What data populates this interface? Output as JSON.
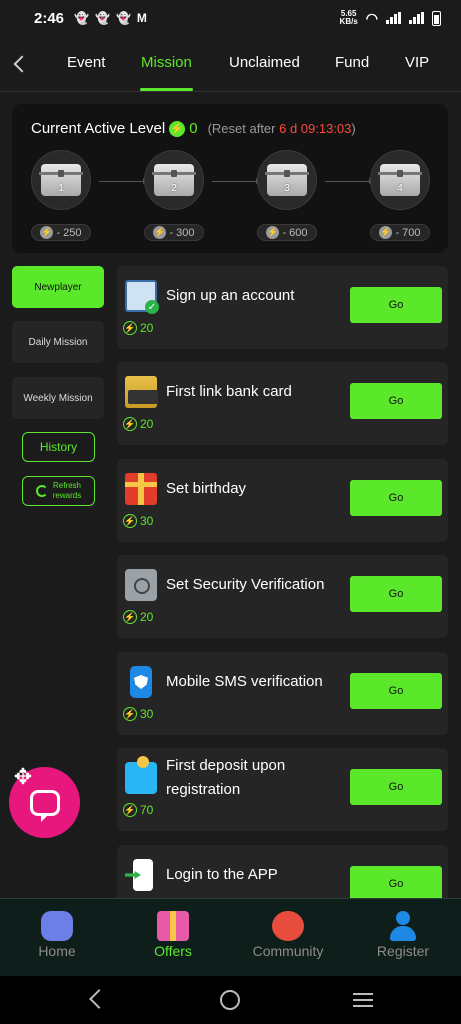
{
  "status_bar": {
    "time": "2:46",
    "speed": "5.65",
    "speed_unit": "KB/s",
    "notif_icons": [
      "snapchat-icon",
      "snapchat-icon",
      "snapchat-icon",
      "gmail-icon"
    ]
  },
  "tabs": [
    {
      "label": "Event"
    },
    {
      "label": "Mission"
    },
    {
      "label": "Unclaimed"
    },
    {
      "label": "Fund"
    },
    {
      "label": "VIP"
    }
  ],
  "level": {
    "title": "Current Active Level",
    "value": "0",
    "reset_prefix": "(Reset after ",
    "countdown": "6 d 09:13:03",
    "reset_suffix": ")",
    "chests": [
      {
        "number": "1",
        "points": "250"
      },
      {
        "number": "2",
        "points": "300"
      },
      {
        "number": "3",
        "points": "600"
      },
      {
        "number": "4",
        "points": "700"
      }
    ]
  },
  "side_nav": {
    "newplayer": "Newplayer",
    "daily": "Daily Mission",
    "weekly": "Weekly Mission",
    "history": "History",
    "refresh_line1": "Refresh",
    "refresh_line2": "rewards"
  },
  "missions": [
    {
      "title": "Sign up an account",
      "reward": "20",
      "button": "Go",
      "icon": "clipboard-check-icon"
    },
    {
      "title": "First link bank card",
      "reward": "20",
      "button": "Go",
      "icon": "bank-card-icon"
    },
    {
      "title": "Set birthday",
      "reward": "30",
      "button": "Go",
      "icon": "gift-icon"
    },
    {
      "title": "Set Security Verification",
      "reward": "20",
      "button": "Go",
      "icon": "safe-icon"
    },
    {
      "title": "Mobile SMS verification",
      "reward": "30",
      "button": "Go",
      "icon": "phone-shield-icon"
    },
    {
      "title": "First deposit upon registration",
      "reward": "70",
      "button": "Go",
      "icon": "wallet-coin-icon"
    },
    {
      "title": "Login to the APP",
      "reward": "",
      "button": "Go",
      "icon": "phone-login-icon"
    }
  ],
  "bottom_nav": [
    {
      "label": "Home"
    },
    {
      "label": "Offers"
    },
    {
      "label": "Community"
    },
    {
      "label": "Register"
    }
  ],
  "colors": {
    "accent": "#5be82b",
    "countdown": "#ff4a3d",
    "chat_button": "#e8177d",
    "background": "#1b1b1b"
  }
}
